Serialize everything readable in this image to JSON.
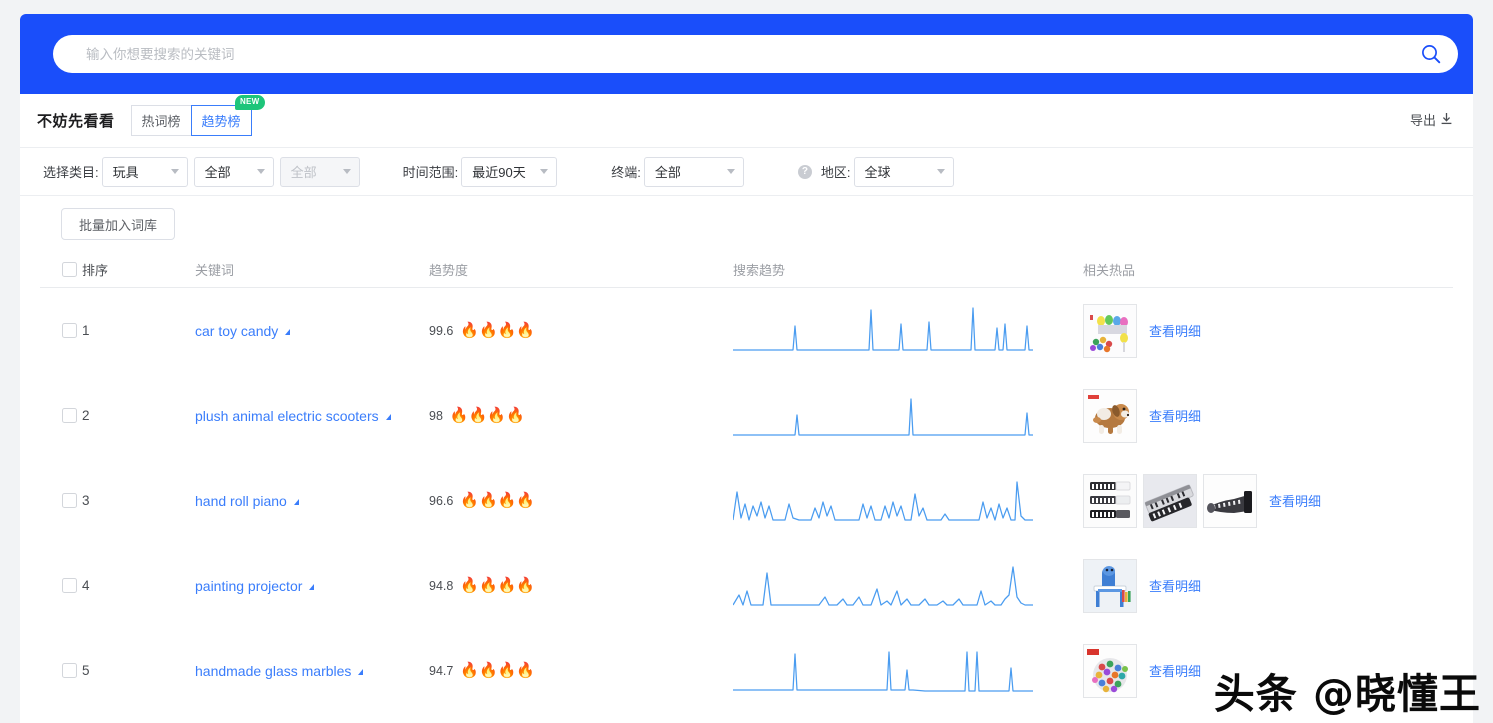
{
  "search": {
    "placeholder": "输入你想要搜索的关键词",
    "value": "",
    "icon": "search-icon"
  },
  "header": {
    "title": "不妨先看看",
    "tabs": [
      {
        "label": "热词榜",
        "active": false
      },
      {
        "label": "趋势榜",
        "active": true,
        "badge": "NEW"
      }
    ],
    "export_label": "导出",
    "export_icon": "download-icon"
  },
  "filters": {
    "category_label": "选择类目:",
    "category_1": "玩具",
    "category_2": "全部",
    "category_3": "全部",
    "time_label": "时间范围:",
    "time_value": "最近90天",
    "terminal_label": "终端:",
    "terminal_value": "全部",
    "help_icon": "question-mark-icon",
    "region_label": "地区:",
    "region_value": "全球"
  },
  "toolbar": {
    "batch_add_label": "批量加入词库"
  },
  "table": {
    "columns": [
      "排序",
      "关键词",
      "趋势度",
      "搜索趋势",
      "相关热品"
    ],
    "detail_link_label": "查看明细",
    "rows": [
      {
        "rank": "1",
        "keyword": "car toy candy",
        "trend_score": "99.6",
        "flames": 4,
        "thumbs": 1,
        "spark": "0,44 18,44 36,44 54,44 60,44 62,20 64,44 82,44 100,44 118,44 130,44 136,44 138,4 140,44 160,44 166,44 168,18 170,44 188,44 194,44 196,16 198,44 216,44 238,44 240,2 242,44 256,44 262,44 264,22 266,44 270,44 272,18 274,44 278,44 284,44 288,44 292,44 294,20 296,44 300,44"
      },
      {
        "rank": "2",
        "keyword": "plush animal electric scooters",
        "trend_score": "98",
        "flames": 4,
        "thumbs": 1,
        "spark": "0,44 22,44 40,44 58,44 62,44 64,24 66,44 86,44 110,44 140,44 170,44 176,44 178,8 180,44 200,44 226,44 250,44 268,44 278,44 288,44 292,44 294,22 296,44 300,44"
      },
      {
        "rank": "3",
        "keyword": "hand roll piano",
        "trend_score": "96.6",
        "flames": 4,
        "thumbs": 3,
        "spark": "0,44 4,16 8,42 12,28 16,44 20,30 24,40 28,26 32,42 36,30 40,44 46,44 52,44 56,28 60,42 66,44 72,44 78,44 82,32 86,42 90,26 94,40 98,30 102,44 110,44 118,44 126,44 130,28 134,42 138,30 142,44 148,44 152,30 156,42 160,26 164,40 168,30 172,44 178,44 182,18 186,40 190,32 194,44 202,44 208,44 212,38 216,44 224,44 232,44 240,44 246,44 250,26 254,42 258,32 262,44 266,28 270,42 274,32 278,44 282,44 284,6 288,40 292,44 296,44 300,44"
      },
      {
        "rank": "4",
        "keyword": "painting projector",
        "trend_score": "94.8",
        "flames": 4,
        "thumbs": 1,
        "spark": "0,44 6,34 10,44 14,30 18,44 24,44 30,44 34,12 38,44 46,44 56,44 68,44 78,44 86,44 92,36 96,44 104,44 110,38 114,44 120,44 126,36 130,44 138,44 144,28 148,44 154,40 158,44 164,30 168,44 174,38 178,44 186,44 192,38 196,44 204,44 210,40 214,44 220,44 226,38 230,44 238,44 244,44 248,30 252,44 258,40 262,44 268,44 272,38 276,34 280,6 284,36 288,42 292,44 300,44"
      },
      {
        "rank": "5",
        "keyword": "handmade glass marbles",
        "trend_score": "94.7",
        "flames": 4,
        "thumbs": 1,
        "spark": "0,44 20,44 40,44 56,44 60,44 62,8 64,44 84,44 110,44 136,44 150,44 154,44 156,6 158,44 166,44 172,44 174,24 176,44 180,44 192,45 210,45 224,45 232,45 234,6 236,45 242,45 244,6 246,45 250,45 262,45 270,45 276,45 278,22 280,45 300,45"
      }
    ]
  },
  "watermark": {
    "text": "头条 @晓懂王"
  },
  "colors": {
    "brand_blue": "#1a4efa",
    "link_blue": "#3a7dfb",
    "flame_orange": "#ff6a00",
    "badge_green": "#1ec57a",
    "spark_blue": "#4a9cf0"
  }
}
